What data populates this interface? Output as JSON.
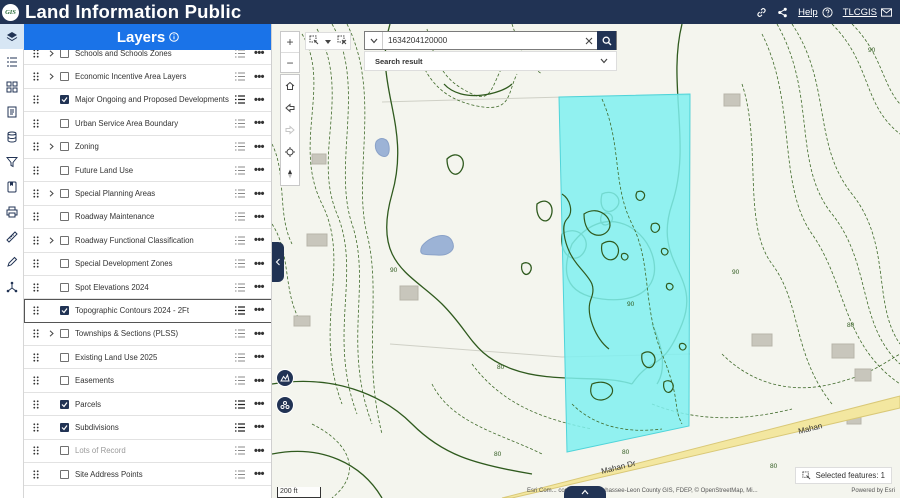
{
  "header": {
    "title": "Land Information Public",
    "logo_text": "GIS",
    "help_label": "Help",
    "user_label": "TLCGIS"
  },
  "rail": {
    "icons": [
      "layers-icon",
      "list-icon",
      "grid-icon",
      "document-icon",
      "database-icon",
      "filter-icon",
      "bookmark-icon",
      "print-icon",
      "measure-icon",
      "draw-icon",
      "network-icon"
    ]
  },
  "layers": {
    "title": "Layers",
    "items": [
      {
        "label": "Schools and Schools Zones",
        "expandable": true,
        "checked": false
      },
      {
        "label": "Economic Incentive Area Layers",
        "expandable": true,
        "checked": false
      },
      {
        "label": "Major Ongoing and Proposed Developments",
        "expandable": false,
        "checked": true
      },
      {
        "label": "Urban Service Area Boundary",
        "expandable": false,
        "checked": false
      },
      {
        "label": "Zoning",
        "expandable": true,
        "checked": false
      },
      {
        "label": "Future Land Use",
        "expandable": false,
        "checked": false
      },
      {
        "label": "Special Planning Areas",
        "expandable": true,
        "checked": false
      },
      {
        "label": "Roadway Maintenance",
        "expandable": false,
        "checked": false
      },
      {
        "label": "Roadway Functional Classification",
        "expandable": true,
        "checked": false
      },
      {
        "label": "Special Development Zones",
        "expandable": false,
        "checked": false
      },
      {
        "label": "Spot Elevations 2024",
        "expandable": false,
        "checked": false
      },
      {
        "label": "Topographic Contours 2024 - 2Ft",
        "expandable": false,
        "checked": true,
        "selected": true
      },
      {
        "label": "Townships & Sections (PLSS)",
        "expandable": true,
        "checked": false
      },
      {
        "label": "Existing Land Use 2025",
        "expandable": false,
        "checked": false
      },
      {
        "label": "Easements",
        "expandable": false,
        "checked": false
      },
      {
        "label": "Parcels",
        "expandable": false,
        "checked": true
      },
      {
        "label": "Subdivisions",
        "expandable": false,
        "checked": true
      },
      {
        "label": "Lots of Record",
        "expandable": false,
        "checked": false,
        "dim": true
      },
      {
        "label": "Site Address Points",
        "expandable": false,
        "checked": false
      }
    ]
  },
  "search": {
    "value": "1634204120000",
    "result_label": "Search result"
  },
  "map": {
    "road_label": "Mahan Dr",
    "road_label_2": "Mahan",
    "contour_labels": [
      "90",
      "90",
      "90",
      "80",
      "80",
      "80",
      "80",
      "80",
      "90"
    ],
    "scale_label": "200 ft",
    "attribution_left": "Esri Com... contributors, Tallahassee-Leon County GIS, FDEP, © OpenStreetMap, Mi...",
    "attribution_right": "Powered by Esri",
    "selected_features_label": "Selected features: 1",
    "selection_color": "#7ff0f0",
    "contour_color": "#2f5a1e"
  }
}
